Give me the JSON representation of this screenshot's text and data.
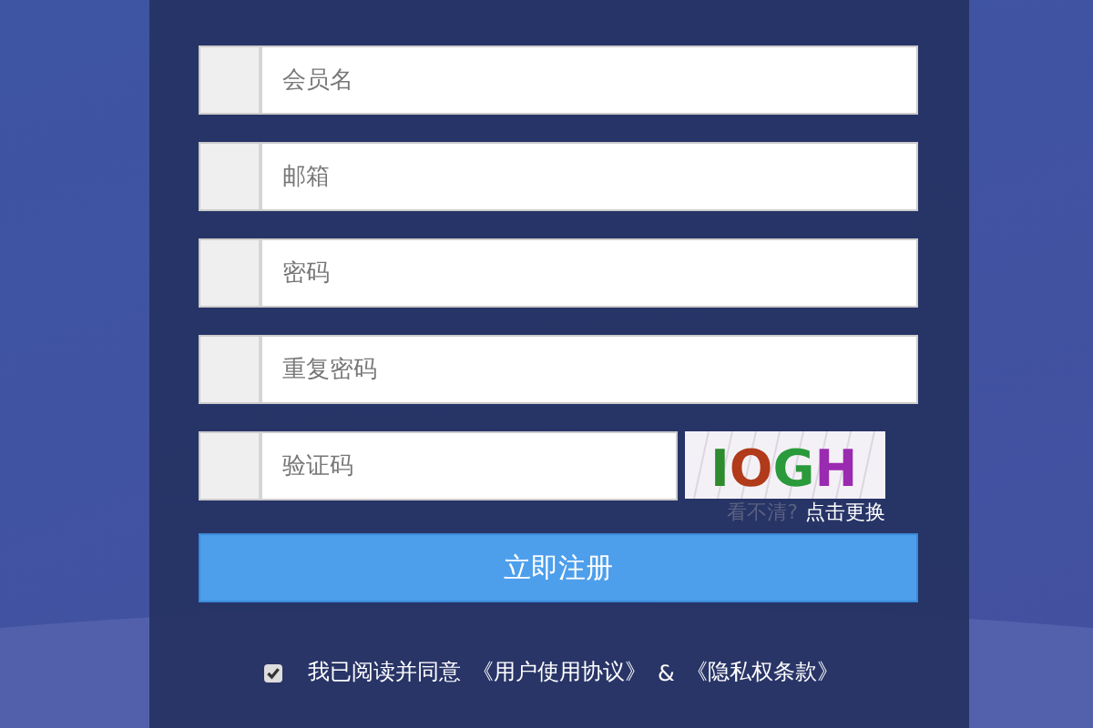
{
  "fields": [
    {
      "placeholder": "会员名"
    },
    {
      "placeholder": "邮箱"
    },
    {
      "placeholder": "密码"
    },
    {
      "placeholder": "重复密码"
    }
  ],
  "captcha": {
    "placeholder": "验证码",
    "code": "IOGH",
    "hint": "看不清?",
    "refresh": "点击更换"
  },
  "submit": "立即注册",
  "agreement": {
    "checked": true,
    "text": "我已阅读并同意",
    "terms": "《用户使用协议》",
    "and": "&",
    "privacy": "《隐私权条款》"
  }
}
